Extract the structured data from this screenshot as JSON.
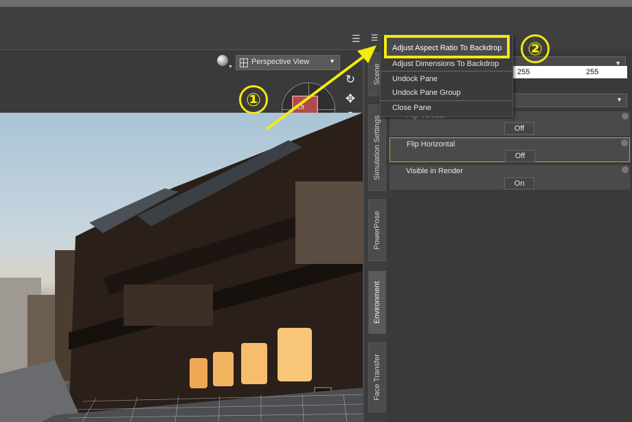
{
  "viewport": {
    "view_label": "Perspective View",
    "cube_label": "Lft"
  },
  "tabs": [
    "Scene",
    "Simulation Settings",
    "PowerPose",
    "Environment",
    "Face Transfer"
  ],
  "panel": {
    "color_values": [
      "255",
      "255"
    ],
    "properties": [
      {
        "name": "Flip Vertical",
        "value": "Off"
      },
      {
        "name": "Flip Horizontal",
        "value": "Off"
      },
      {
        "name": "Visible in Render",
        "value": "On"
      }
    ]
  },
  "menu": {
    "items": [
      "Adjust Aspect Ratio To Backdrop",
      "Adjust Dimensions To Backdrop",
      "Undock Pane",
      "Undock Pane Group",
      "Close Pane"
    ]
  },
  "annotations": {
    "step1": "①",
    "step2": "②",
    "color": "#f2ea10"
  }
}
